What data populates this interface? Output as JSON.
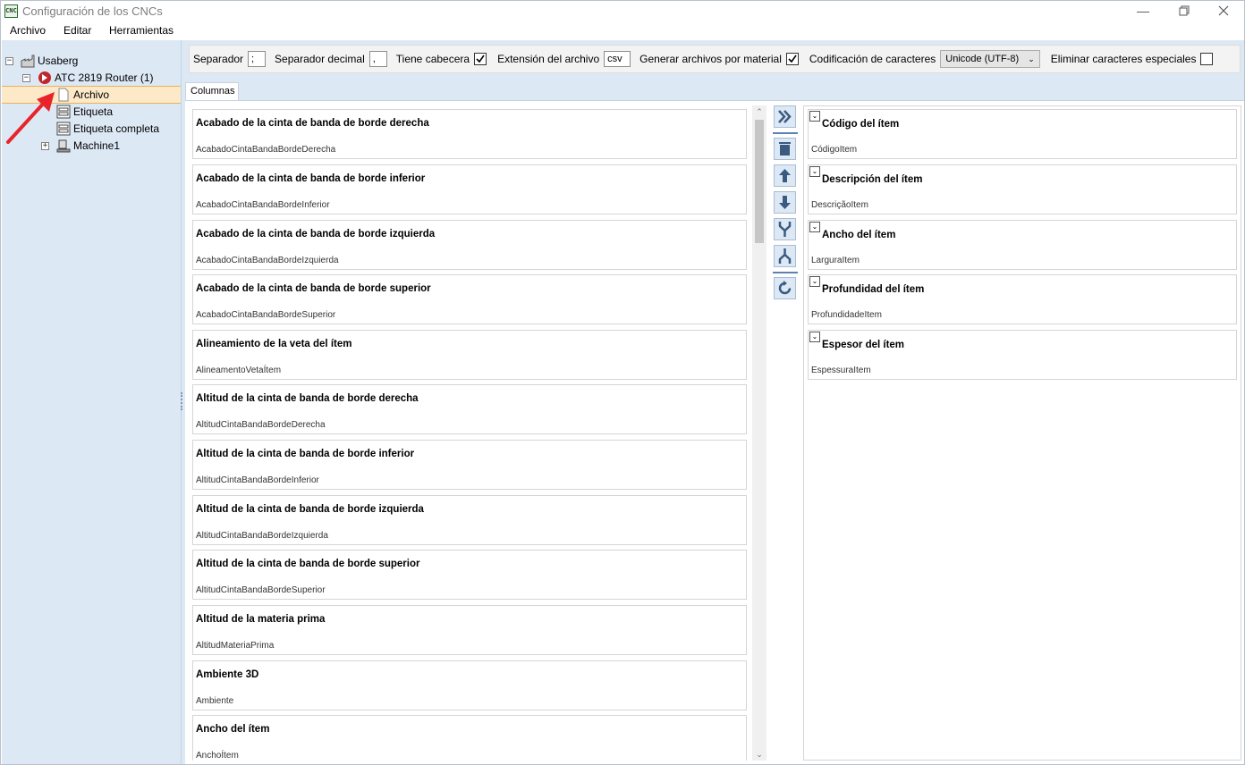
{
  "window": {
    "title": "Configuración de los CNCs",
    "app_icon": "CNC"
  },
  "menu": [
    "Archivo",
    "Editar",
    "Herramientas"
  ],
  "tree": {
    "root": "Usaberg",
    "machine": "ATC 2819 Router (1)",
    "children": [
      "Archivo",
      "Etiqueta",
      "Etiqueta completa"
    ],
    "machine1": "Machine1"
  },
  "toolbar": {
    "separator_label": "Separador",
    "separator_value": ";",
    "decimal_label": "Separador decimal",
    "decimal_value": ",",
    "header_label": "Tiene cabecera",
    "header_checked": true,
    "ext_label": "Extensión del archivo",
    "ext_value": "csv",
    "per_material_label": "Generar archivos por material",
    "per_material_checked": true,
    "encoding_label": "Codificación de caracteres",
    "encoding_value": "Unicode (UTF-8)",
    "remove_special_label": "Eliminar caracteres especiales",
    "remove_special_checked": false
  },
  "tab": "Columnas",
  "available_columns": [
    {
      "title": "Acabado de la cinta de banda de borde derecha",
      "key": "AcabadoCintaBandaBordeDerecha"
    },
    {
      "title": "Acabado de la cinta de banda de borde inferior",
      "key": "AcabadoCintaBandaBordeInferior"
    },
    {
      "title": "Acabado de la cinta de banda de borde izquierda",
      "key": "AcabadoCintaBandaBordeIzquierda"
    },
    {
      "title": "Acabado de la cinta de banda de borde superior",
      "key": "AcabadoCintaBandaBordeSuperior"
    },
    {
      "title": "Alineamiento de la veta del ítem",
      "key": "AlineamentoVetaÍtem"
    },
    {
      "title": "Altitud de la cinta de banda de borde derecha",
      "key": "AltitudCintaBandaBordeDerecha"
    },
    {
      "title": "Altitud de la cinta de banda de borde inferior",
      "key": "AltitudCintaBandaBordeInferior"
    },
    {
      "title": "Altitud de la cinta de banda de borde izquierda",
      "key": "AltitudCintaBandaBordeIzquierda"
    },
    {
      "title": "Altitud de la cinta de banda de borde superior",
      "key": "AltitudCintaBandaBordeSuperior"
    },
    {
      "title": "Altitud de la materia prima",
      "key": "AltitudMateriaPrima"
    },
    {
      "title": "Ambiente 3D",
      "key": "Ambiente"
    },
    {
      "title": "Ancho del ítem",
      "key": "AnchoÍtem"
    }
  ],
  "selected_columns": [
    {
      "title": "Código del ítem",
      "key": "CódigoItem"
    },
    {
      "title": "Descripción del ítem",
      "key": "DescriçãoItem"
    },
    {
      "title": "Ancho del ítem",
      "key": "LarguraItem"
    },
    {
      "title": "Profundidad del ítem",
      "key": "ProfundidadeItem"
    },
    {
      "title": "Espesor del ítem",
      "key": "EspessuraItem"
    }
  ],
  "action_icons": [
    "add-all-icon",
    "delete-icon",
    "move-up-icon",
    "move-down-icon",
    "merge-icon",
    "split-icon",
    "refresh-icon"
  ],
  "colors": {
    "accent": "#dde8f5",
    "selection": "#fde9c8",
    "annotation_arrow": "#e8242a"
  }
}
